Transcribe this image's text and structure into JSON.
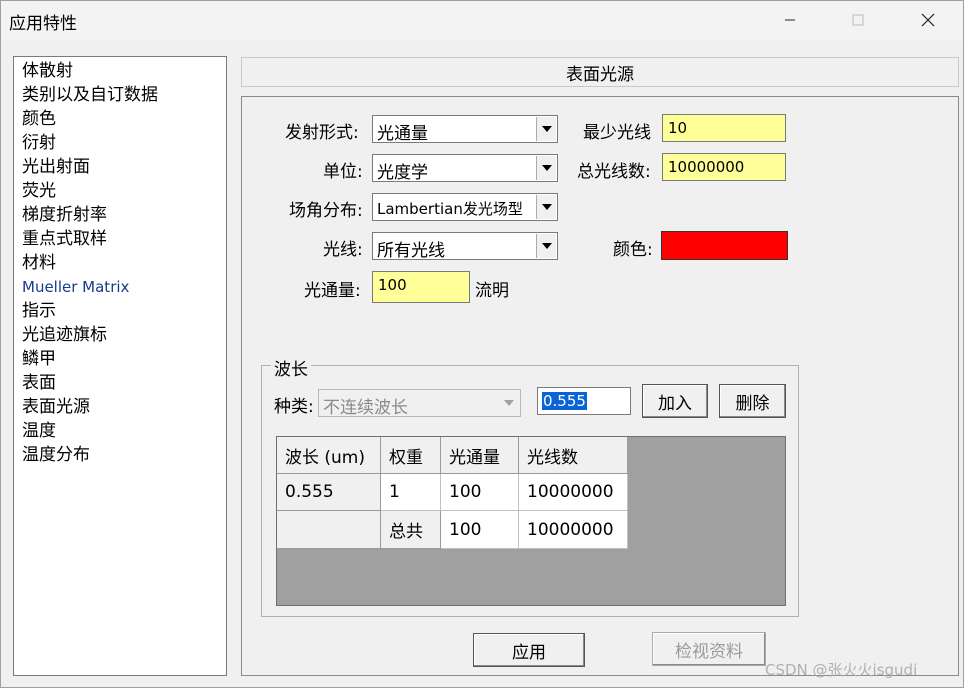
{
  "window": {
    "title": "应用特性"
  },
  "sidebar": {
    "items": [
      "体散射",
      "类别以及自订数据",
      "颜色",
      "衍射",
      "光出射面",
      "荧光",
      "梯度折射率",
      "重点式取样",
      "材料",
      "Mueller Matrix",
      "指示",
      "光追迹旗标",
      "鳞甲",
      "表面",
      "表面光源",
      "温度",
      "温度分布"
    ]
  },
  "panel": {
    "title": "表面光源"
  },
  "form": {
    "emission_label": "发射形式:",
    "emission_value": "光通量",
    "unit_label": "单位:",
    "unit_value": "光度学",
    "angular_label": "场角分布:",
    "angular_value": "Lambertian发光场型",
    "rays_label": "光线:",
    "rays_value": "所有光线",
    "flux_label": "光通量:",
    "flux_value": "100",
    "flux_unit": "流明",
    "min_rays_label": "最少光线",
    "min_rays_value": "10",
    "total_rays_label": "总光线数:",
    "total_rays_value": "10000000",
    "color_label": "颜色:",
    "color_value": "#ff0000"
  },
  "wavelength": {
    "group_title": "波长",
    "type_label": "种类:",
    "type_value": "不连续波长",
    "input_value": "0.555",
    "add_button": "加入",
    "delete_button": "删除",
    "table": {
      "headers": [
        "波长 (um)",
        "权重",
        "光通量",
        "光线数"
      ],
      "rows": [
        [
          "0.555",
          "1",
          "100",
          "10000000"
        ],
        [
          "",
          "总共",
          "100",
          "10000000"
        ]
      ]
    }
  },
  "buttons": {
    "apply": "应用",
    "view_data": "检视资料"
  },
  "watermark": "CSDN @张火火isgudi"
}
